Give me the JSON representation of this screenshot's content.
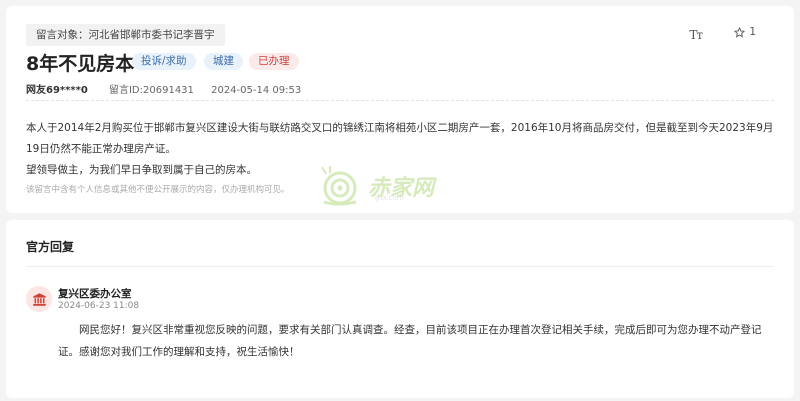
{
  "message": {
    "target_label": "留言对象：河北省邯郸市委书记李晋宇",
    "title": "8年不见房本",
    "tags": [
      "投诉/求助",
      "城建",
      "已办理"
    ],
    "font_size_icon": "text-size-icon",
    "font_size_glyph": "Tт",
    "favorite_count": "1",
    "author": "网友69****0",
    "message_id": "留言ID:20691431",
    "timestamp": "2024-05-14 09:53",
    "body_paragraphs": [
      "本人于2014年2月购买位于邯郸市复兴区建设大街与联纺路交叉口的锦绣江南将相苑小区二期房产一套，2016年10月将商品房交付，但是截至到今天2023年9月19日仍然不能正常办理房产证。",
      "望领导做主，为我们早日争取到属于自己的房本。"
    ],
    "privacy_note": "该留言中含有个人信息或其他不便公开展示的内容，仅办理机构可见。"
  },
  "watermark": {
    "text": "赤家网",
    "url": "ljnx.com"
  },
  "official_reply": {
    "section_title": "官方回复",
    "office_icon": "government-building-icon",
    "office_name": "复兴区委办公室",
    "reply_time": "2024-06-23 11:08",
    "reply_text": "网民您好！复兴区非常重视您反映的问题，要求有关部门认真调查。经查，目前该项目正在办理首次登记相关手续，完成后即可为您办理不动产登记证。感谢您对我们工作的理解和支持，祝生活愉快！"
  },
  "colors": {
    "tag_blue_bg": "#e9f1fb",
    "tag_blue_text": "#3f6fa8",
    "tag_red_bg": "#fbeaea",
    "tag_red_text": "#d0413a",
    "icon_red": "#d0413a"
  }
}
